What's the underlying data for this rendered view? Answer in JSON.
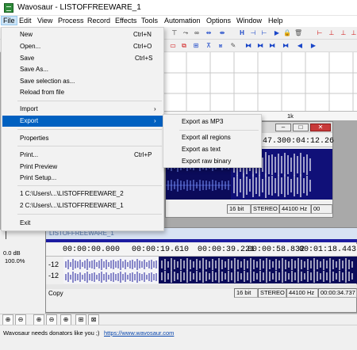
{
  "window": {
    "title": "Wavosaur - LISTOFFREEWARE_1"
  },
  "menubar": [
    "File",
    "Edit",
    "View",
    "Process",
    "Record",
    "Effects",
    "Tools",
    "Automation",
    "Options",
    "Window",
    "Help"
  ],
  "file_menu": {
    "new": {
      "label": "New",
      "shortcut": "Ctrl+N"
    },
    "open": {
      "label": "Open...",
      "shortcut": "Ctrl+O"
    },
    "save": {
      "label": "Save",
      "shortcut": "Ctrl+S"
    },
    "save_as": {
      "label": "Save As..."
    },
    "save_selection": {
      "label": "Save selection as..."
    },
    "reload": {
      "label": "Reload from file"
    },
    "import": {
      "label": "Import"
    },
    "export": {
      "label": "Export"
    },
    "properties": {
      "label": "Properties"
    },
    "print": {
      "label": "Print...",
      "shortcut": "Ctrl+P"
    },
    "print_preview": {
      "label": "Print Preview"
    },
    "print_setup": {
      "label": "Print Setup..."
    },
    "recent1": {
      "label": "1 C:\\Users\\...\\LISTOFFREEWARE_2"
    },
    "recent2": {
      "label": "2 C:\\Users\\...\\LISTOFFREEWARE_1"
    },
    "exit": {
      "label": "Exit"
    }
  },
  "export_menu": [
    "Export as MP3",
    "Export all regions",
    "Export as text",
    "Export raw binary"
  ],
  "back_window": {
    "ruler_tick": "1k",
    "timecode": "03:47.300:04:12.26",
    "status": {
      "bits": "16 bit",
      "channels": "STEREO",
      "rate": "44100 Hz",
      "extra": "00"
    }
  },
  "front_window": {
    "title": "LISTOFFREEWARE_1",
    "timecodes": [
      "00:00:00.000",
      "00:00:19.610",
      "00:00:39.221",
      "00:00:58.832",
      "00:01:18.443"
    ],
    "scale": [
      "-12",
      "-12"
    ],
    "status": {
      "action": "Copy",
      "bits": "16 bit",
      "channels": "STEREO",
      "rate": "44100 Hz",
      "position": "00:00:34.737 -"
    }
  },
  "left_panel": {
    "db": "0.0 dB",
    "pct": "100.0%"
  },
  "statusbar": {
    "message": "Wavosaur needs donators like you ;)",
    "url": "https://www.wavosaur.com"
  }
}
